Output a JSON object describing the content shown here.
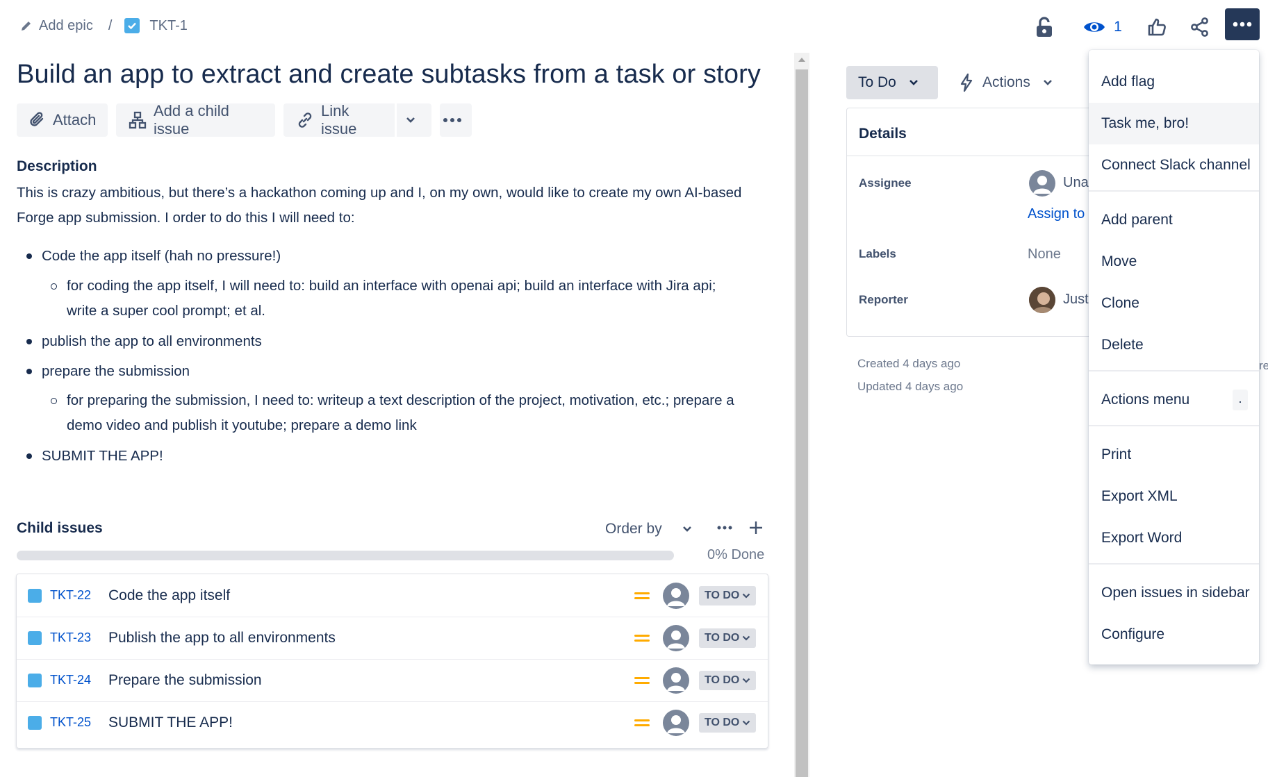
{
  "breadcrumb": {
    "epic_label": "Add epic",
    "separator": "/",
    "issue_key": "TKT-1"
  },
  "toolbar": {
    "watch_count": "1"
  },
  "issue": {
    "title": "Build an app to extract and create subtasks from a task or story"
  },
  "buttons": {
    "attach": "Attach",
    "add_child": "Add a child issue",
    "link_issue": "Link issue"
  },
  "description": {
    "heading": "Description",
    "intro_line1": "This is crazy ambitious, but there’s a hackathon coming up and I, on my own, would like to create my own AI-based",
    "intro_line2": "Forge app submission. I order to do this I will need to:",
    "b1": "Code the app itself (hah no pressure!)",
    "b1_sub_line1": "for coding the app itself, I will need to: build an interface with openai api; build an interface with Jira api;",
    "b1_sub_line2": "write a super cool prompt; et al.",
    "b2": "publish the app to all environments",
    "b3": "prepare the submission",
    "b3_sub_line1": "for preparing the submission, I need to: writeup a text description of the project, motivation, etc.; prepare a",
    "b3_sub_line2": "demo video and publish it youtube; prepare a demo link",
    "b4": "SUBMIT THE APP!"
  },
  "child_issues": {
    "heading": "Child issues",
    "order_by": "Order by",
    "progress_percent": 0,
    "progress_label": "0% Done",
    "rows": [
      {
        "key": "TKT-22",
        "summary": "Code the app itself",
        "status": "TO DO"
      },
      {
        "key": "TKT-23",
        "summary": "Publish the app to all environments",
        "status": "TO DO"
      },
      {
        "key": "TKT-24",
        "summary": "Prepare the submission",
        "status": "TO DO"
      },
      {
        "key": "TKT-25",
        "summary": "SUBMIT THE APP!",
        "status": "TO DO"
      }
    ]
  },
  "sidebar": {
    "status": "To Do",
    "actions": "Actions",
    "details_heading": "Details",
    "assignee_label": "Assignee",
    "assignee_value": "Una",
    "assign_link": "Assign to",
    "labels_label": "Labels",
    "labels_value": "None",
    "reporter_label": "Reporter",
    "reporter_value": "Just",
    "created": "Created 4 days ago",
    "updated": "Updated 4 days ago",
    "edge_text": "re"
  },
  "menu": {
    "add_flag": "Add flag",
    "task_me": "Task me, bro!",
    "connect_slack": "Connect Slack channel",
    "add_parent": "Add parent",
    "move": "Move",
    "clone": "Clone",
    "delete": "Delete",
    "actions_menu": "Actions menu",
    "actions_menu_shortcut": ".",
    "print": "Print",
    "export_xml": "Export XML",
    "export_word": "Export Word",
    "open_sidebar": "Open issues in sidebar",
    "configure": "Configure"
  },
  "colors": {
    "link": "#0052cc",
    "priority_medium": "#ffab00",
    "menu_button": "#253858",
    "task_icon": "#4bade8"
  }
}
